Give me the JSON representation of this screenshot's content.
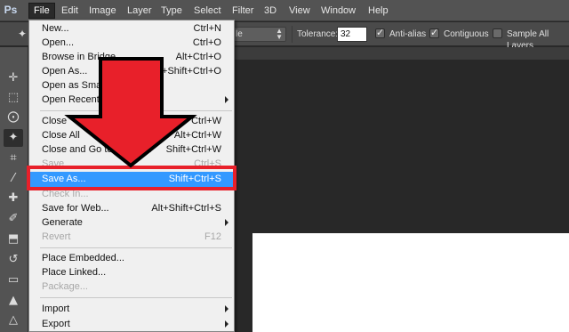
{
  "app": {
    "logo_text": "Ps"
  },
  "menubar": {
    "items": [
      {
        "label": "File",
        "state": "open"
      },
      {
        "label": "Edit"
      },
      {
        "label": "Image"
      },
      {
        "label": "Layer"
      },
      {
        "label": "Type"
      },
      {
        "label": "Select"
      },
      {
        "label": "Filter"
      },
      {
        "label": "3D"
      },
      {
        "label": "View"
      },
      {
        "label": "Window"
      },
      {
        "label": "Help"
      }
    ]
  },
  "options_bar": {
    "tool_icon": "magic-wand-icon",
    "sample_size_value": "le",
    "tolerance_label": "Tolerance:",
    "tolerance_value": "32",
    "anti_alias_label": "Anti-alias",
    "anti_alias_checked": true,
    "contiguous_label": "Contiguous",
    "contiguous_checked": true,
    "sample_all_label": "Sample All Layers",
    "sample_all_checked": false
  },
  "toolbar": {
    "tools": [
      {
        "name": "move-tool",
        "glyph": "✛"
      },
      {
        "name": "marquee-tool",
        "glyph": "⬚"
      },
      {
        "name": "lasso-tool",
        "glyph": "⨀"
      },
      {
        "name": "magic-wand-tool",
        "glyph": "✦",
        "active": true
      },
      {
        "name": "crop-tool",
        "glyph": "⌗"
      },
      {
        "name": "eyedropper-tool",
        "glyph": "⁄"
      },
      {
        "name": "healing-brush-tool",
        "glyph": "✚"
      },
      {
        "name": "brush-tool",
        "glyph": "✐"
      },
      {
        "name": "clone-stamp-tool",
        "glyph": "⬒"
      },
      {
        "name": "history-brush-tool",
        "glyph": "↺"
      },
      {
        "name": "eraser-tool",
        "glyph": "▭"
      },
      {
        "name": "paint-bucket-tool",
        "glyph": "▲"
      },
      {
        "name": "blur-tool",
        "glyph": "△"
      }
    ]
  },
  "file_menu": {
    "items": [
      {
        "label": "New...",
        "shortcut": "Ctrl+N"
      },
      {
        "label": "Open...",
        "shortcut": "Ctrl+O"
      },
      {
        "label": "Browse in Bridge...",
        "shortcut": "Alt+Ctrl+O"
      },
      {
        "label": "Open As...",
        "shortcut": "Alt+Shift+Ctrl+O"
      },
      {
        "label": "Open as Smart Object...",
        "shortcut": ""
      },
      {
        "label": "Open Recent",
        "shortcut": "",
        "submenu": true
      },
      {
        "separator": true
      },
      {
        "label": "Close",
        "shortcut": "Ctrl+W"
      },
      {
        "label": "Close All",
        "shortcut": "Alt+Ctrl+W"
      },
      {
        "label": "Close and Go to Bridge...",
        "shortcut": "Shift+Ctrl+W"
      },
      {
        "label": "Save",
        "shortcut": "Ctrl+S",
        "disabled": true
      },
      {
        "label": "Save As...",
        "shortcut": "Shift+Ctrl+S",
        "highlight": true
      },
      {
        "label": "Check In...",
        "shortcut": "",
        "disabled": true
      },
      {
        "label": "Save for Web...",
        "shortcut": "Alt+Shift+Ctrl+S"
      },
      {
        "label": "Generate",
        "shortcut": "",
        "submenu": true
      },
      {
        "label": "Revert",
        "shortcut": "F12",
        "disabled": true
      },
      {
        "separator": true
      },
      {
        "label": "Place Embedded...",
        "shortcut": ""
      },
      {
        "label": "Place Linked...",
        "shortcut": ""
      },
      {
        "label": "Package...",
        "shortcut": "",
        "disabled": true
      },
      {
        "separator": true
      },
      {
        "label": "Import",
        "shortcut": "",
        "submenu": true
      },
      {
        "label": "Export",
        "shortcut": "",
        "submenu": true
      }
    ]
  },
  "colors": {
    "highlight": "#3399ff",
    "annotation_red": "#e8202a",
    "menu_bg": "#f0f0f0",
    "chrome_bg": "#535353"
  }
}
